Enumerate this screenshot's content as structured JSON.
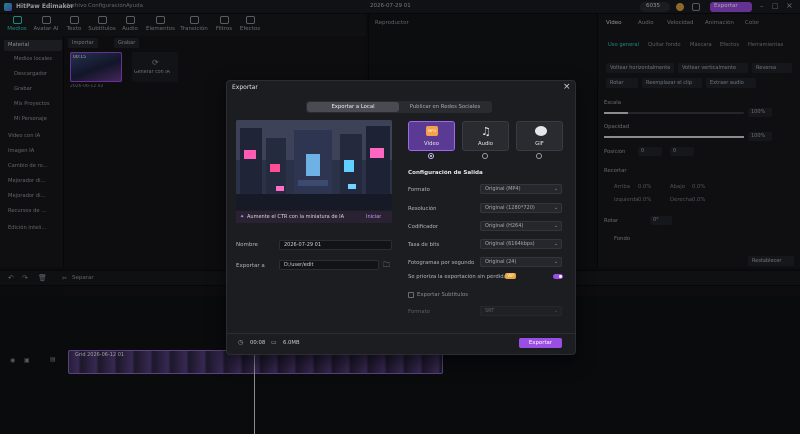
{
  "titlebar": {
    "app_name": "HitPaw Edimakor",
    "menu": [
      "Archivo",
      "Configuración",
      "Ayuda"
    ],
    "date": "2026-07-29 01",
    "credits": "6035",
    "export_label": "Exportar"
  },
  "media_tabs": [
    {
      "label": "Medios",
      "active": true
    },
    {
      "label": "Avatar AI",
      "active": false
    },
    {
      "label": "Texto",
      "active": false
    },
    {
      "label": "Subtítulos",
      "active": false
    },
    {
      "label": "Audio",
      "active": false
    },
    {
      "label": "Elementos",
      "active": false
    },
    {
      "label": "Transición",
      "active": false
    },
    {
      "label": "Filtros",
      "active": false
    },
    {
      "label": "Efectos",
      "active": false
    }
  ],
  "sidebar": {
    "items": [
      {
        "label": "Material",
        "active": true
      },
      {
        "label": "Medios locales",
        "active": false
      },
      {
        "label": "Descargador",
        "active": false
      },
      {
        "label": "Grabar",
        "active": false
      },
      {
        "label": "Mis Proyectos",
        "active": false
      },
      {
        "label": "Mi Personaje",
        "active": false
      },
      {
        "label": "Video con IA",
        "active": false
      },
      {
        "label": "Imagen IA",
        "active": false
      },
      {
        "label": "Cambio de ro...",
        "active": false
      },
      {
        "label": "Mejorador di...",
        "active": false
      },
      {
        "label": "Mejorador di...",
        "active": false
      },
      {
        "label": "Recursos de ...",
        "active": false
      },
      {
        "label": "Edición inteli...",
        "active": false
      }
    ]
  },
  "media": {
    "import_label": "Importar",
    "record_label": "Grabar",
    "thumb_duration": "00:15",
    "thumb_date": "2026-06-12 02",
    "generate_label": "Generar con IA"
  },
  "player": {
    "title": "Reproductor"
  },
  "right_panel": {
    "tabs": [
      {
        "label": "Vídeo",
        "active": true
      },
      {
        "label": "Audio",
        "active": false
      },
      {
        "label": "Velocidad",
        "active": false
      },
      {
        "label": "Animación",
        "active": false
      },
      {
        "label": "Color",
        "active": false
      }
    ],
    "subtabs": [
      {
        "label": "Uso general",
        "active": true
      },
      {
        "label": "Quitar fondo",
        "active": false
      },
      {
        "label": "Máscara",
        "active": false
      },
      {
        "label": "Efectos",
        "active": false
      },
      {
        "label": "Herramientas",
        "active": false
      }
    ],
    "btn_flip_h": "Voltear horizontalmente",
    "btn_flip_v": "Voltear verticalmente",
    "btn_reverse": "Reversa",
    "btn_rotate": "Rotar",
    "btn_replace": "Reemplazar el clip",
    "btn_extract": "Extraer audio",
    "scale_label": "Escala",
    "scale_value": "100%",
    "opacity_label": "Opacidad",
    "opacity_value": "100%",
    "position_label": "Posición",
    "position_x": "0",
    "position_y": "0",
    "crop_label": "Recortar",
    "crop_top": "Arriba",
    "crop_top_val": "0.0%",
    "crop_bottom": "Abajo",
    "crop_bottom_val": "0.0%",
    "crop_left": "Izquierda",
    "crop_left_val": "0.0%",
    "crop_right": "Derecha",
    "crop_right_val": "0.0%",
    "rotate_label": "Rotar",
    "rotate_value": "0°",
    "background_label": "Fondo",
    "reset_label": "Restablecer"
  },
  "timeline": {
    "split_label": "Separar",
    "clip_label": "Grid 2026-06-12 01"
  },
  "dialog": {
    "title": "Exportar",
    "tabs": [
      {
        "label": "Exportar a Local",
        "active": true
      },
      {
        "label": "Publicar en Redes Sociales",
        "active": false
      }
    ],
    "ctr_text": "Aumente el CTR con la miniatura de IA",
    "ctr_action": "Iniciar",
    "name_label": "Nombre",
    "name_value": "2026-07-29 01",
    "export_to_label": "Exportar a",
    "export_to_value": "D:/user/edit",
    "formats": [
      {
        "label": "Vídeo",
        "badge": "MP4",
        "active": true
      },
      {
        "label": "Audio",
        "active": false
      },
      {
        "label": "GIF",
        "active": false
      }
    ],
    "config_title": "Configuración de Salida",
    "config": [
      {
        "label": "Formato",
        "value": "Original (MP4)"
      },
      {
        "label": "Resolución",
        "value": "Original (1280*720)"
      },
      {
        "label": "Codificador",
        "value": "Original (H264)"
      },
      {
        "label": "Tasa de bits",
        "value": "Original (6164kbps)"
      },
      {
        "label": "Fotogramas por segundo",
        "value": "Original (24)"
      }
    ],
    "lossless_label": "Se prioriza la exportación sin pérdidas",
    "vip_label": "VIP",
    "subtitles_label": "Exportar Subtítulos",
    "subtitle_format_label": "Formato",
    "subtitle_format_value": "SRT",
    "duration": "00:08",
    "filesize": "6.0MB",
    "export_button": "Exportar"
  }
}
